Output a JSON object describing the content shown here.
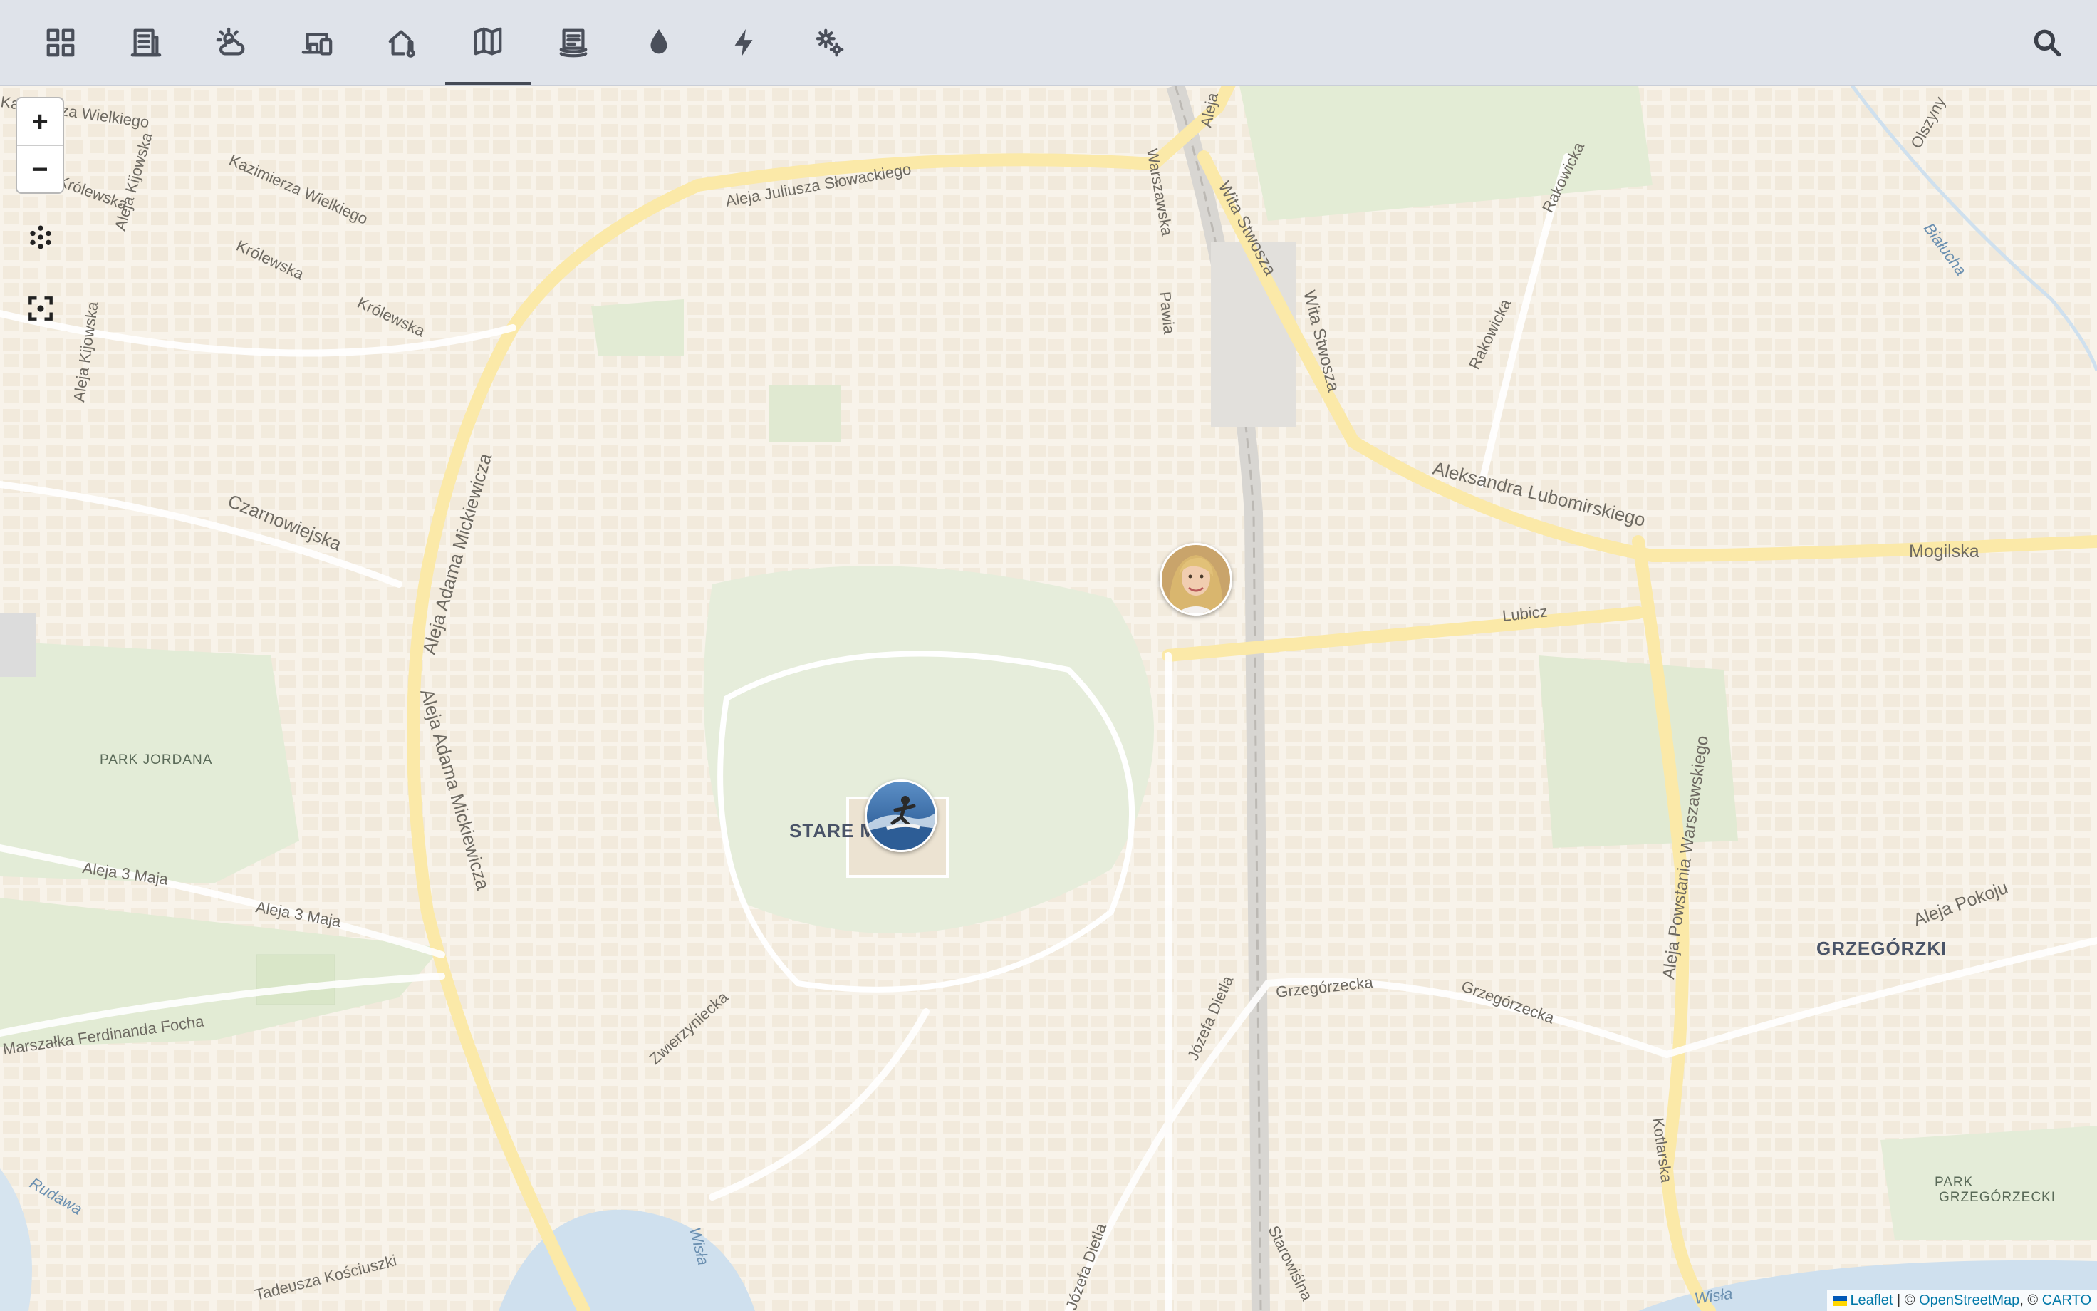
{
  "toolbar": {
    "tabs": [
      {
        "icon": "grid-icon"
      },
      {
        "icon": "building-icon"
      },
      {
        "icon": "weather-icon"
      },
      {
        "icon": "devices-icon"
      },
      {
        "icon": "home-thermometer-icon"
      },
      {
        "icon": "map-icon",
        "active": true
      },
      {
        "icon": "layers-icon"
      },
      {
        "icon": "water-drop-icon"
      },
      {
        "icon": "lightning-icon"
      },
      {
        "icon": "cogs-icon"
      }
    ],
    "search_icon": "search-icon"
  },
  "map": {
    "zoom_in": "+",
    "zoom_out": "−",
    "streets": {
      "s1": "Aleja Juliusza Słowackiego",
      "s2": "Kazimierza Wielkiego",
      "s3": "Królewska",
      "s4": "Królewska",
      "s5": "Aleja Kijowska",
      "s6": "Aleja Kijowska",
      "s7": "Czarnowiejska",
      "s8": "Aleja Adama Mickiewicza",
      "s9": "Aleja Adama Mickiewicza",
      "s10": "Aleja 3 Maja",
      "s11": "Aleja 3 Maja",
      "s12": "Marszałka Ferdinanda Focha",
      "s13": "Zwierzyniecka",
      "s14": "Warszawska",
      "s15": "Pawia",
      "s16": "Wita Stwosza",
      "s17": "Wita Stwosza",
      "s18": "Aleksandra Lubomirskiego",
      "s19": "Rakowicka",
      "s20": "Mogilska",
      "s21": "Lubicz",
      "s22": "Aleja Powstania Warszawskiego",
      "s23": "Grzegórzecka",
      "s24": "Grzegórzecka",
      "s25": "Józefa Dietla",
      "s26": "Józefa Dietla",
      "s27": "Aleja Pokoju",
      "s28": "Kotlarska",
      "s29": "Starowiślna",
      "s30": "Tadeusza Kościuszki",
      "s31": "Rudawa",
      "s32": "Wisła",
      "s33": "Białucha",
      "s34": "Olszyny",
      "s35": "Aleja",
      "s36": "Wisła",
      "s37": "Rakowicka"
    },
    "districts": {
      "stare_miasto": "STARE M",
      "grzegorzki": "GRZEGÓRZKI"
    },
    "parks": {
      "jordana": "PARK JORDANA",
      "grzegorzecki_1": "PARK",
      "grzegorzecki_2": "GRZEGÓRZECKI"
    }
  },
  "attribution": {
    "leaflet": "Leaflet",
    "sep1": " | © ",
    "osm": "OpenStreetMap",
    "sep2": ", © ",
    "carto": "CARTO"
  }
}
